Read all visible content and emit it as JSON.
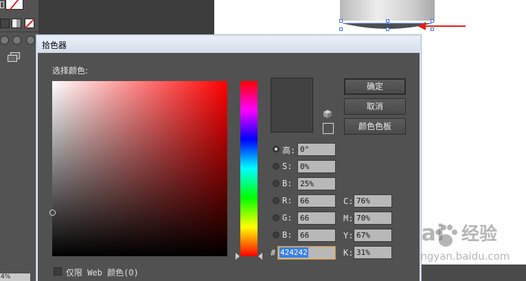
{
  "dialog": {
    "title": "拾色器",
    "select_label": "选择颜色:",
    "buttons": {
      "ok": "确定",
      "cancel": "取消",
      "swatches": "颜色色板"
    },
    "web_only_label": "仅限 Web 颜色(O)",
    "current_color": "#424242",
    "hsb": [
      {
        "label": "高:",
        "value": "0°",
        "checked": true
      },
      {
        "label": "S:",
        "value": "0%",
        "checked": false
      },
      {
        "label": "B:",
        "value": "25%",
        "checked": false
      }
    ],
    "rgb": [
      {
        "label": "R:",
        "value": "66"
      },
      {
        "label": "G:",
        "value": "66"
      },
      {
        "label": "B:",
        "value": "66"
      }
    ],
    "cmyk": [
      {
        "label": "C:",
        "value": "76%"
      },
      {
        "label": "M:",
        "value": "70%"
      },
      {
        "label": "Y:",
        "value": "67%"
      },
      {
        "label": "K:",
        "value": "31%"
      }
    ],
    "hex_label": "#",
    "hex_value": "424242"
  },
  "background": {
    "zoom_text": "4%",
    "watermark_logo": "Bai",
    "watermark_cn": "经验",
    "watermark_url": "jingyan.baidu.com"
  },
  "colors": {
    "accent_red": "#e0201a",
    "selection_blue": "#3b7fe0",
    "hex_border": "#d98d1a"
  }
}
